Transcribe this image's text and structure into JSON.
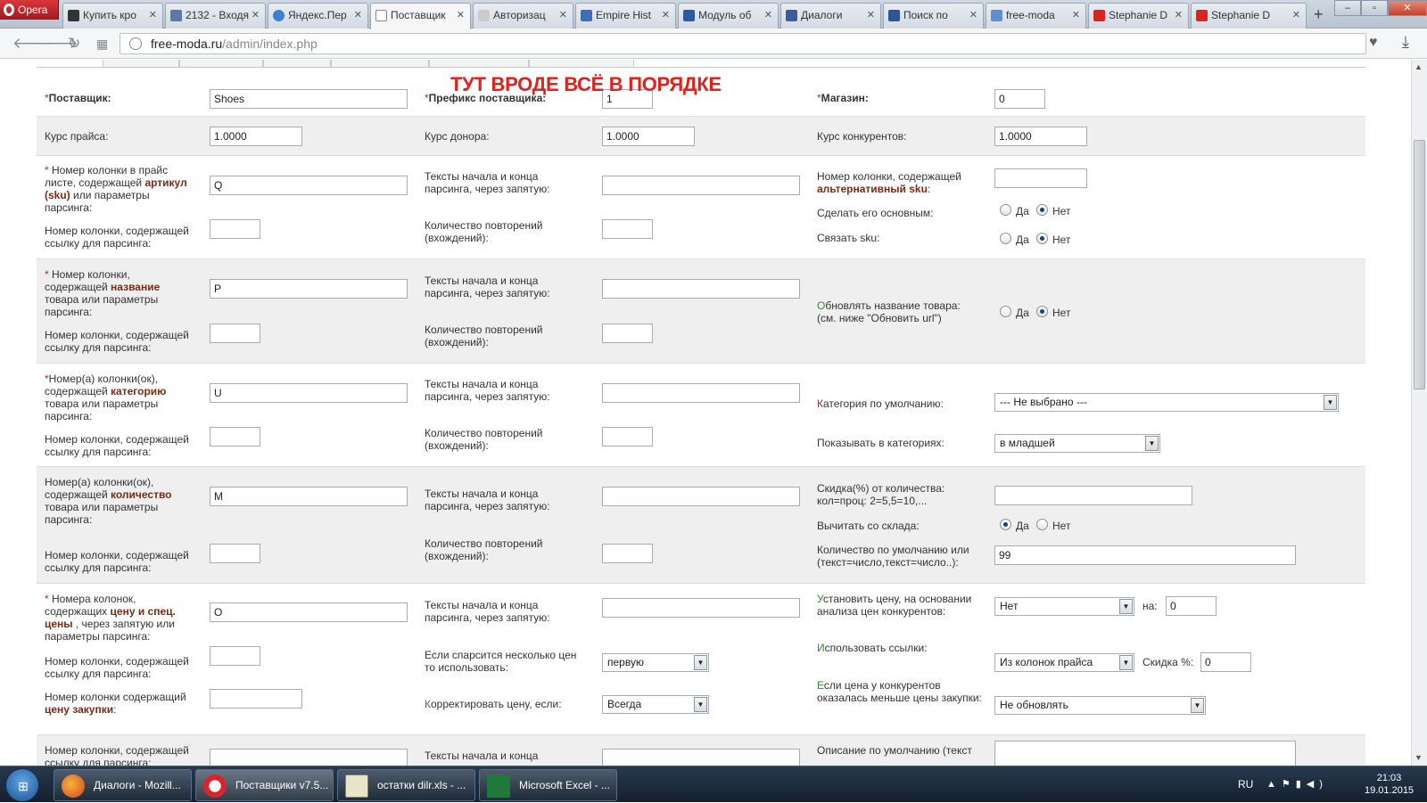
{
  "browser": {
    "opera_label": "Opera",
    "tabs": [
      {
        "label": "Купить кро"
      },
      {
        "label": "2132 - Входя"
      },
      {
        "label": "Яндекс.Пер"
      },
      {
        "label": "Поставщик"
      },
      {
        "label": "Авторизац"
      },
      {
        "label": "Empire Hist"
      },
      {
        "label": "Модуль об"
      },
      {
        "label": "Диалоги"
      },
      {
        "label": "Поиск по"
      },
      {
        "label": "free-moda"
      },
      {
        "label": "Stephanie D"
      },
      {
        "label": "Stephanie D"
      }
    ],
    "new_tab": "+",
    "url_host": "free-moda.ru",
    "url_path": "/admin/index.php",
    "win_minimize": "–",
    "win_maximize": "▫",
    "win_close": "✕"
  },
  "annotation": "ТУТ ВРОДЕ ВСЁ В ПОРЯДКЕ",
  "form": {
    "supplier_label": "Поставщик:",
    "supplier_value": "Shoes",
    "prefix_label": "Префикс поставщика:",
    "prefix_value": "1",
    "shop_label": "Магазин:",
    "shop_value": "0",
    "price_rate_label": "Курс прайса:",
    "price_rate_value": "1.0000",
    "donor_rate_label": "Курс донора:",
    "donor_rate_value": "1.0000",
    "competitor_rate_label": "Курс конкурентов:",
    "competitor_rate_value": "1.0000",
    "sku_label_pre": "Номер колонки в прайс листе, содержащей ",
    "sku_label_kw": "артикул (sku)",
    "sku_label_post": " или параметры парсинга:",
    "sku_value": "Q",
    "link_col_label": "Номер колонки, содержащей ссылку для парсинга:",
    "parse_texts_label": "Тексты начала и конца парсинга, через запятую:",
    "repeat_count_label": "Количество повторений (вхождений):",
    "alt_sku_label_pre": "Номер колонки, содержащей ",
    "alt_sku_label_kw": "альтернативный sku",
    "make_main_label": "Сделать его основным:",
    "link_sku_label": "Связать sku:",
    "yes": "Да",
    "no": "Нет",
    "name_label_pre": "Номер колонки, содержащей ",
    "name_label_kw": "название",
    "name_label_post": " товара или параметры парсинга:",
    "name_value": "P",
    "update_name_first": "О",
    "update_name_label": "бновлять название товара:",
    "update_name_note": "(см. ниже \"Обновить url\")",
    "category_label_pre": "Номер(а) колонки(ок), содержащей ",
    "category_label_kw": "категорию",
    "category_label_post": " товара или параметры парсинга:",
    "category_value": "U",
    "default_category_first": "К",
    "default_category_label": "атегория по умолчанию:",
    "default_category_value": "--- Не выбрано ---",
    "show_in_categories_label": "Показывать в категориях:",
    "show_in_categories_value": "в младшей",
    "qty_label_pre": "Номер(а) колонки(ок), содержащей ",
    "qty_label_kw": "количество",
    "qty_label_post": " товара или параметры парсинга:",
    "qty_value": "M",
    "discount_qty_label": "Скидка(%) от количества: кол=проц: 2=5,5=10,...",
    "subtract_stock_label": "Вычитать со склада:",
    "default_qty_label": "Количество по умолчанию или (текст=число,текст=число..):",
    "default_qty_value": "99",
    "price_label_pre": "Номера колонок, содержащих ",
    "price_label_kw": "цену и спец. цены",
    "price_label_post": " , через запятую или параметры парсинга:",
    "price_value": "O",
    "set_price_first": "У",
    "set_price_label": "становить цену, на основании анализа цен конкурентов:",
    "set_price_value": "Нет",
    "on_label": "на:",
    "on_value": "0",
    "multi_price_label": "Если спарсится несколько цен то использовать:",
    "multi_price_value": "первую",
    "use_links_first": "И",
    "use_links_label": "спользовать ссылки:",
    "use_links_value": "Из колонок прайса",
    "discount_label": "Скидка %:",
    "discount_value": "0",
    "purchase_col_label_pre": "Номер колонки содержащий ",
    "purchase_col_label_kw": "цену закупки",
    "correct_price_first": "К",
    "correct_price_label": "орректировать цену, если:",
    "correct_price_value": "Всегда",
    "competitor_lower_first": "Е",
    "competitor_lower_label": "сли цена у конкурентов оказалась меньше цены закупки:",
    "competitor_lower_value": "Не обновлять",
    "default_desc_label": "Описание по умолчанию (текст"
  },
  "taskbar": {
    "items": [
      {
        "label": "Диалоги - Mozill..."
      },
      {
        "label": "Поставщики v7.5..."
      },
      {
        "label": "остатки dilr.xls - ..."
      },
      {
        "label": "Microsoft Excel - ..."
      }
    ],
    "lang": "RU",
    "time": "21:03",
    "date": "19.01.2015"
  }
}
